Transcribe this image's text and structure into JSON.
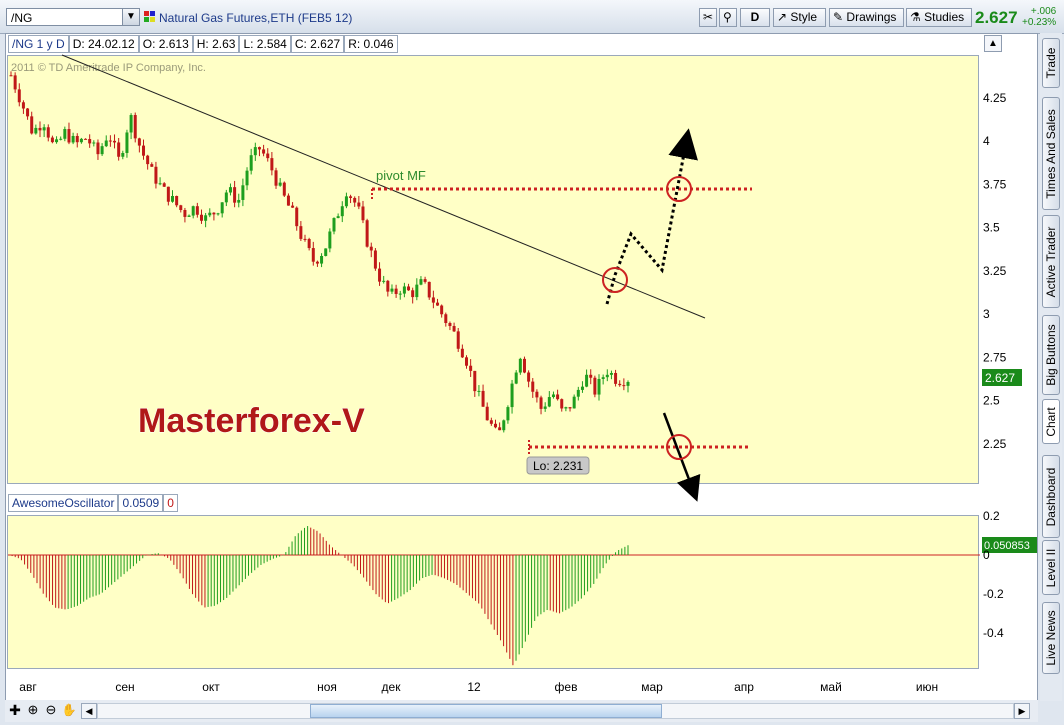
{
  "toolbar": {
    "symbol_value": "/NG",
    "instrument_title": "Natural Gas Futures,ETH (FEB5 12)",
    "aggregation_label": "D",
    "style_label": "Style",
    "drawings_label": "Drawings",
    "studies_label": "Studies",
    "last_price": "2.627",
    "net_change": "+.006",
    "pct_change": "+0.23%"
  },
  "chart_header": {
    "symbol_period": "/NG 1 y D",
    "date": "D: 24.02.12",
    "open": "O: 2.613",
    "high": "H: 2.63",
    "low": "L: 2.584",
    "close": "C: 2.627",
    "range": "R: 0.046"
  },
  "copyright": "2011 © TD Ameritrade IP Company, Inc.",
  "annotations": {
    "pivot_label": "pivot MF",
    "watermark": "Masterforex-V",
    "lo_label": "Lo: 2.231",
    "price_badge": "2.627",
    "osc_badge": "0.050853"
  },
  "oscillator": {
    "name": "AwesomeOscillator",
    "value": "0.0509",
    "value2": "0"
  },
  "side_tabs": [
    "Trade",
    "Times And Sales",
    "Active Trader",
    "Big Buttons",
    "Chart",
    "Dashboard",
    "Level II",
    "Live News"
  ],
  "colors": {
    "up": "#1e9e1e",
    "down": "#c01818",
    "pivot": "#cc2222",
    "watermark": "#b01818"
  },
  "chart_data": [
    {
      "type": "candlestick",
      "y_ticks": [
        "4.25",
        "4",
        "3.75",
        "3.5",
        "3.25",
        "3",
        "2.75",
        "2.5",
        "2.25"
      ],
      "ylim": [
        2.12,
        4.38
      ],
      "x_ticks": [
        "авг",
        "сен",
        "окт",
        "ноя",
        "дек",
        "12",
        "фев",
        "мар",
        "апр",
        "май",
        "июн"
      ],
      "series_close": [
        4.38,
        4.22,
        4.05,
        4.12,
        3.95,
        4.05,
        3.98,
        4.02,
        3.92,
        4.05,
        3.88,
        4.15,
        3.95,
        3.82,
        3.72,
        3.65,
        3.58,
        3.62,
        3.55,
        3.6,
        3.72,
        3.65,
        3.88,
        3.96,
        3.85,
        3.7,
        3.58,
        3.42,
        3.3,
        3.38,
        3.55,
        3.72,
        3.62,
        3.4,
        3.22,
        3.1,
        3.15,
        3.12,
        3.18,
        3.08,
        2.98,
        2.88,
        2.75,
        2.55,
        2.4,
        2.28,
        2.52,
        2.78,
        2.58,
        2.45,
        2.55,
        2.42,
        2.5,
        2.65,
        2.55,
        2.68,
        2.62,
        2.627
      ],
      "low": 2.231,
      "pivot_level": 3.72
    },
    {
      "type": "bar",
      "name": "AwesomeOscillator",
      "y_ticks": [
        "0.2",
        "0",
        "-0.2",
        "-0.4"
      ],
      "ylim": [
        -0.58,
        0.2
      ],
      "last_value": 0.0509
    }
  ]
}
